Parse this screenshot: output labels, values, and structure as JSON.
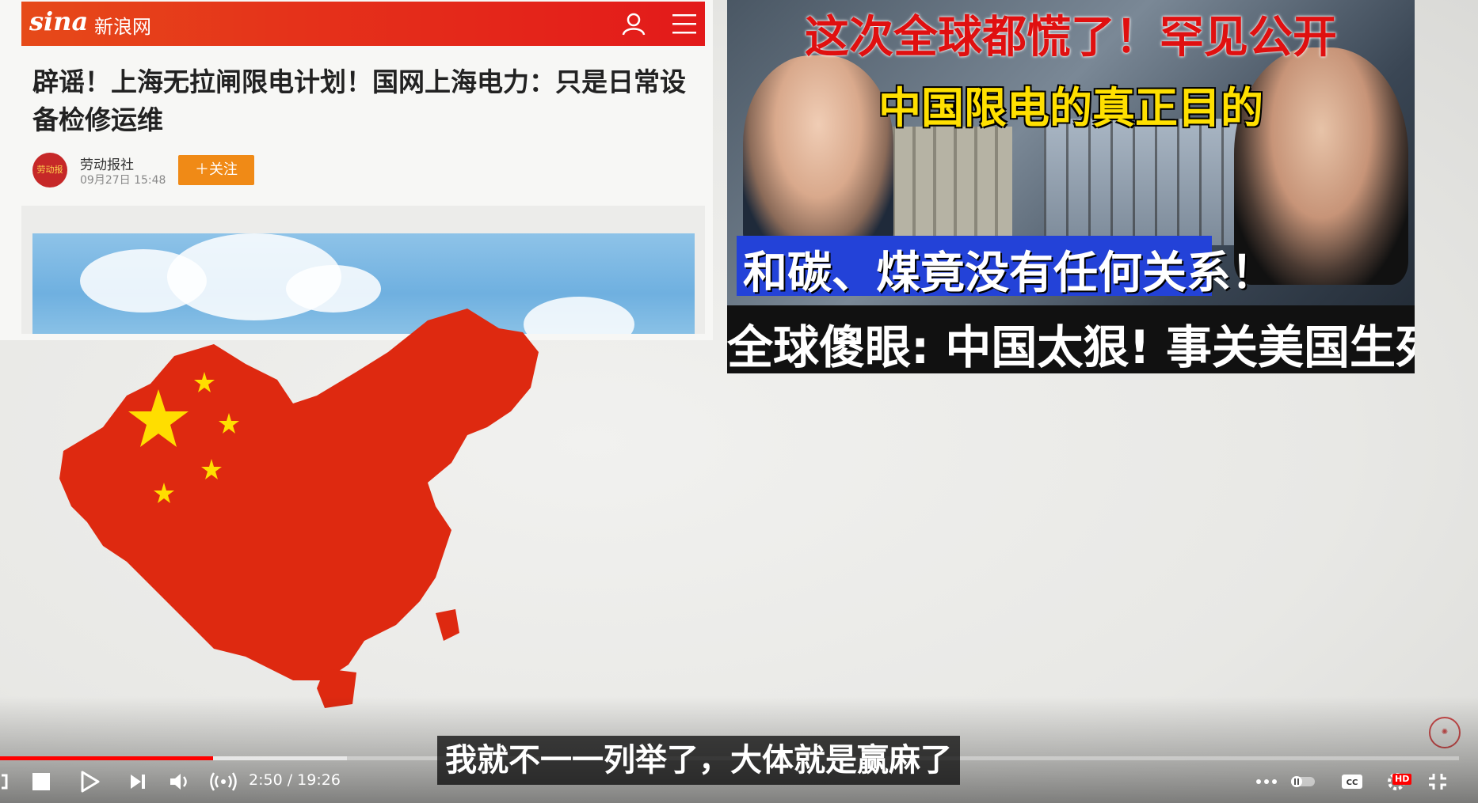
{
  "sina": {
    "logo": "sina",
    "site_name": "新浪网",
    "article_title": "辟谣！上海无拉闸限电计划！国网上海电力：只是日常设备检修运维",
    "author_name": "劳动报社",
    "author_avatar_text": "劳动报",
    "publish_date": "09月27日  15:48",
    "follow_label": "＋关注"
  },
  "thumbnail": {
    "line1": "这次全球都慌了！罕见公开",
    "line2": "中国限电的真正目的",
    "line3": "和碳、煤竟没有任何关系！",
    "line4": "全球傻眼: 中国太狠! 事关美国生死!"
  },
  "player": {
    "subtitle": "我就不一一列举了，大体就是赢麻了",
    "time_current": "2:50",
    "time_separator": " / ",
    "time_total": "19:26",
    "progress_played_fraction": 0.146,
    "progress_buffered_fraction": 0.238,
    "hd_badge": "HD"
  },
  "colors": {
    "sina_red": "#e5321a",
    "follow_orange": "#f08a16",
    "youtube_red": "#ff0000",
    "china_red": "#de2910",
    "star_yellow": "#ffde00"
  },
  "icons": {
    "sina_user": "user-icon",
    "sina_menu": "menu-icon",
    "loop": "loop-icon",
    "stop": "stop-icon",
    "play": "play-icon",
    "next": "next-icon",
    "volume": "volume-icon",
    "live": "broadcast-icon",
    "more": "more-icon",
    "autoplay": "autoplay-toggle-icon",
    "captions": "captions-icon",
    "settings": "settings-icon",
    "fullscreen_exit": "exit-fullscreen-icon"
  }
}
